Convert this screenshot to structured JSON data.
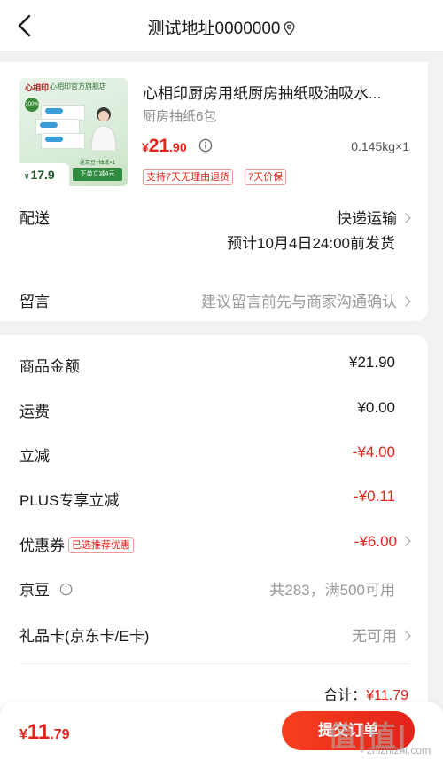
{
  "header": {
    "title": "测试地址0000000"
  },
  "product": {
    "image": {
      "brand": "心相印",
      "brand_sub": "心相印官方旗舰店",
      "badge": "100%",
      "price": "17.9",
      "price_prefix": "¥",
      "promo_top": "返京豆+抽纸×1",
      "promo": "下单立减4元"
    },
    "title": "心相印厨房用纸厨房抽纸吸油吸水...",
    "spec": "厨房抽纸6包",
    "price": {
      "currency": "¥",
      "int": "21",
      "dec": ".90"
    },
    "qty": "0.145kg×1",
    "tags": [
      "支持7天无理由退货",
      "7天价保"
    ]
  },
  "delivery": {
    "label": "配送",
    "method": "快递运输",
    "eta": "预计10月4日24:00前发货"
  },
  "message": {
    "label": "留言",
    "placeholder": "建议留言前先与商家沟通确认"
  },
  "summary": {
    "goods_label": "商品金额",
    "goods_value": "¥21.90",
    "shipping_label": "运费",
    "shipping_value": "¥0.00",
    "discount_label": "立减",
    "discount_value": "-¥4.00",
    "plus_label": "PLUS专享立减",
    "plus_value": "-¥0.11",
    "coupon_label": "优惠券",
    "coupon_tag": "已选推荐优惠",
    "coupon_value": "-¥6.00",
    "jingdou_label": "京豆",
    "jingdou_value": "共283，满500可用",
    "giftcard_label": "礼品卡(京东卡/E卡)",
    "giftcard_value": "无可用",
    "total_peek_label": "合计：",
    "total_peek_value": "¥11.79"
  },
  "bottom": {
    "price": {
      "currency": "¥",
      "int": "11",
      "dec": ".79"
    },
    "submit_label": "提交订单",
    "watermark_logo": "值|值|值",
    "watermark_url": "zhizhizhi.com"
  },
  "colors": {
    "accent": "#e2231a",
    "muted": "#999999",
    "background": "#f2f2f2"
  }
}
